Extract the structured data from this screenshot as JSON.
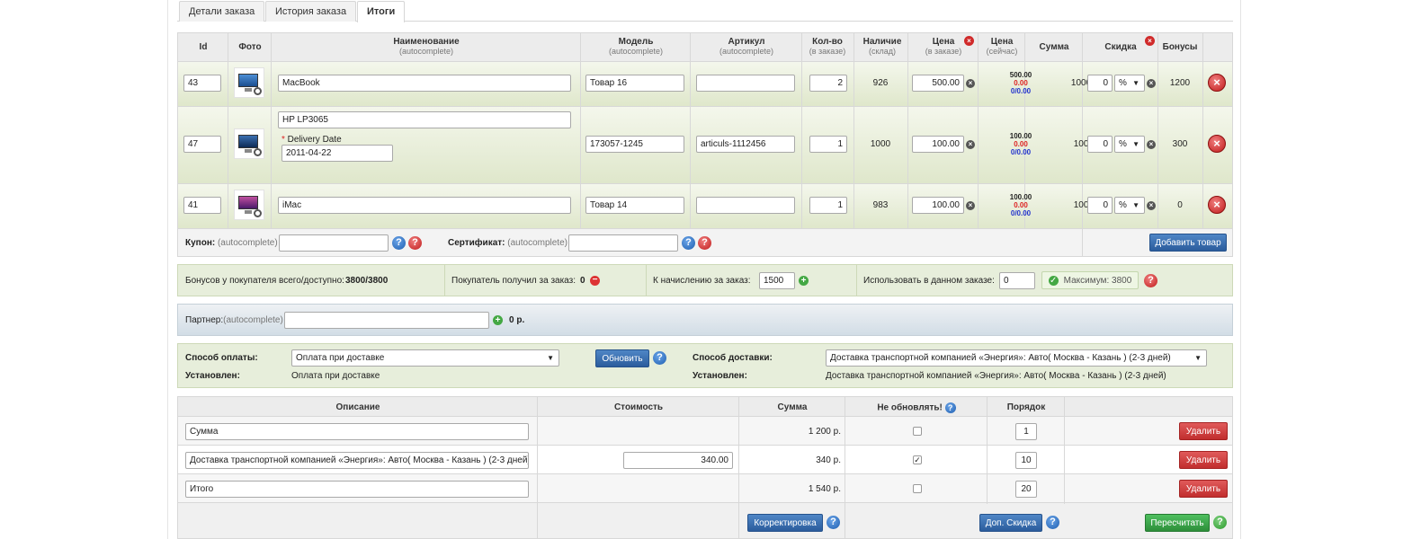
{
  "tabs": [
    {
      "label": "Детали заказа"
    },
    {
      "label": "История заказа"
    },
    {
      "label": "Итоги"
    }
  ],
  "products_table": {
    "headers": {
      "id": "Id",
      "photo": "Фото",
      "name": "Наименование",
      "name_sub": "(autocomplete)",
      "model": "Модель",
      "model_sub": "(autocomplete)",
      "sku": "Артикул",
      "sku_sub": "(autocomplete)",
      "qty": "Кол-во",
      "qty_sub": "(в заказе)",
      "stock": "Наличие",
      "stock_sub": "(склад)",
      "price": "Цена",
      "price_sub": "(в заказе)",
      "price_now": "Цена",
      "price_now_sub": "(сейчас)",
      "sum": "Сумма",
      "discount": "Скидка",
      "bonus": "Бонусы"
    },
    "rows": [
      {
        "id": "43",
        "name": "MacBook",
        "model": "Товар 16",
        "sku": "",
        "qty": "2",
        "stock": "926",
        "price": "500.00",
        "price_now": [
          "500.00",
          "0.00",
          "0/0.00"
        ],
        "sum": "1000.00",
        "discount": "0",
        "discount_type": "%",
        "bonus": "1200"
      },
      {
        "id": "47",
        "name": "HP LP3065",
        "option_label": "Delivery Date",
        "option_value": "2011-04-22",
        "model": "173057-1245",
        "sku": "articuls-1112456",
        "qty": "1",
        "stock": "1000",
        "price": "100.00",
        "price_now": [
          "100.00",
          "0.00",
          "0/0.00"
        ],
        "sum": "100.00",
        "discount": "0",
        "discount_type": "%",
        "bonus": "300"
      },
      {
        "id": "41",
        "name": "iMac",
        "model": "Товар 14",
        "sku": "",
        "qty": "1",
        "stock": "983",
        "price": "100.00",
        "price_now": [
          "100.00",
          "0.00",
          "0/0.00"
        ],
        "sum": "100.00",
        "discount": "0",
        "discount_type": "%",
        "bonus": "0"
      }
    ]
  },
  "coupon": {
    "label": "Купон:",
    "sub": "(autocomplete)",
    "value": ""
  },
  "certificate": {
    "label": "Сертификат:",
    "sub": "(autocomplete)",
    "value": ""
  },
  "add_product_button": "Добавить товар",
  "bonus_bar": {
    "total_label": "Бонусов у покупателя всего/доступно:",
    "total_value": "3800/3800",
    "received_label": "Покупатель получил за заказ:",
    "received_value": "0",
    "accrue_label": "К начислению за заказ:",
    "accrue_value": "1500",
    "use_label": "Использовать в данном заказе:",
    "use_value": "0",
    "max_label": "Максимум: 3800"
  },
  "partner": {
    "label": "Партнер:",
    "sub": "(autocomplete)",
    "value": "",
    "amount": "0 р."
  },
  "payment": {
    "label": "Способ оплаты:",
    "selected": "Оплата при доставке",
    "installed_label": "Установлен:",
    "installed_value": "Оплата при доставке",
    "update_button": "Обновить"
  },
  "shipping": {
    "label": "Способ доставки:",
    "selected": "Доставка транспортной компанией «Энергия»: Авто( Москва - Казань ) (2-3 дней)",
    "installed_label": "Установлен:",
    "installed_value": "Доставка транспортной компанией «Энергия»: Авто( Москва - Казань ) (2-3 дней)"
  },
  "totals_table": {
    "headers": {
      "desc": "Описание",
      "cost": "Стоимость",
      "sum": "Сумма",
      "no_update": "Не обновлять!",
      "order": "Порядок"
    },
    "rows": [
      {
        "desc": "Сумма",
        "cost": "",
        "sum": "1 200 р.",
        "checked": false,
        "order": "1"
      },
      {
        "desc": "Доставка транспортной компанией «Энергия»: Авто( Москва - Казань ) (2-3 дней)",
        "cost": "340.00",
        "sum": "340 р.",
        "checked": true,
        "order": "10"
      },
      {
        "desc": "Итого",
        "cost": "",
        "sum": "1 540 р.",
        "checked": false,
        "order": "20"
      }
    ],
    "delete_button": "Удалить",
    "correction_button": "Корректировка",
    "extra_discount_button": "Доп. Скидка",
    "recalc_button": "Пересчитать"
  }
}
